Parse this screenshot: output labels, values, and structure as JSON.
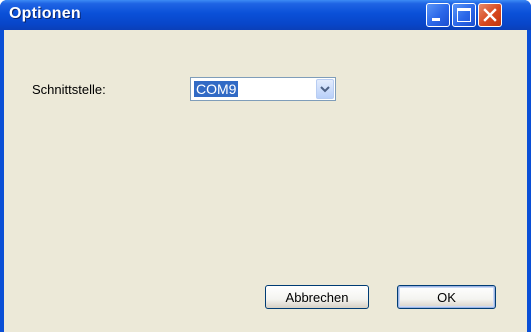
{
  "window": {
    "title": "Optionen"
  },
  "form": {
    "interface_label": "Schnittstelle:",
    "interface_value": "COM9"
  },
  "buttons": {
    "cancel_label": "Abbrechen",
    "ok_label": "OK"
  }
}
